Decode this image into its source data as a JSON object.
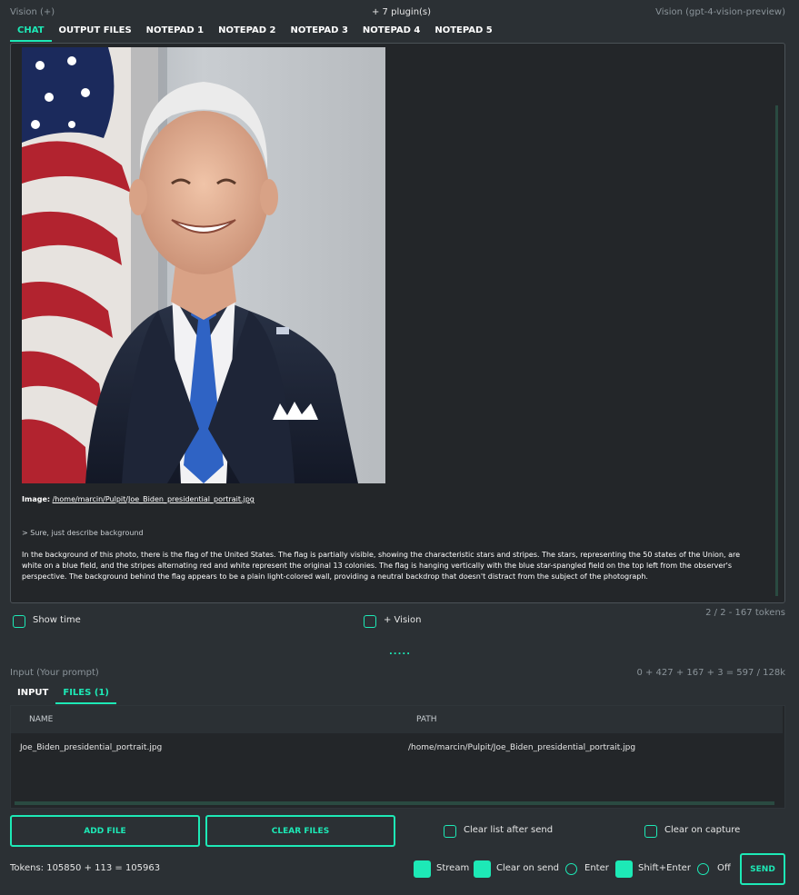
{
  "header": {
    "left": "Vision (+)",
    "center": "+ 7 plugin(s)",
    "right": "Vision (gpt-4-vision-preview)"
  },
  "tabs": [
    "CHAT",
    "OUTPUT FILES",
    "NOTEPAD 1",
    "NOTEPAD 2",
    "NOTEPAD 3",
    "NOTEPAD 4",
    "NOTEPAD 5"
  ],
  "chat": {
    "image_label": "Image:",
    "image_path": "/home/marcin/Pulpit/Joe_Biden_presidential_portrait.jpg",
    "user_prompt": "> Sure, just describe background",
    "answer": "In the background of this photo, there is the flag of the United States. The flag is partially visible, showing the characteristic stars and stripes. The stars, representing the 50 states of the Union, are white on a blue field, and the stripes alternating red and white represent the original 13 colonies. The flag is hanging vertically with the blue star-spangled field on the top left from the observer's perspective. The background behind the flag appears to be a plain light-colored wall, providing a neutral backdrop that doesn't distract from the subject of the photograph."
  },
  "options": {
    "show_time": "Show time",
    "vision": "+ Vision",
    "context_tokens": "2 / 2 - 167 tokens"
  },
  "splitter": ".....",
  "input": {
    "label": "Input (Your prompt)",
    "token_sum": "0 + 427 + 167 + 3 = 597 / 128k",
    "tabs": [
      "INPUT",
      "FILES (1)"
    ],
    "active_tab": "FILES (1)"
  },
  "files": {
    "columns": [
      "NAME",
      "PATH"
    ],
    "rows": [
      {
        "name": "Joe_Biden_presidential_portrait.jpg",
        "path": "/home/marcin/Pulpit/Joe_Biden_presidential_portrait.jpg"
      }
    ]
  },
  "buttons": {
    "add_file": "ADD FILE",
    "clear_files": "CLEAR FILES",
    "send": "SEND"
  },
  "checks": {
    "clear_list_after_send": "Clear list after send",
    "clear_on_capture": "Clear on capture",
    "stream": "Stream",
    "clear_on_send": "Clear on send",
    "enter": "Enter",
    "shift_enter": "Shift+Enter",
    "off": "Off"
  },
  "footer": {
    "tokens": "Tokens: 105850 + 113 = 105963"
  },
  "colors": {
    "accent": "#1de9b6",
    "background": "#2b3034",
    "panel": "#232629"
  }
}
